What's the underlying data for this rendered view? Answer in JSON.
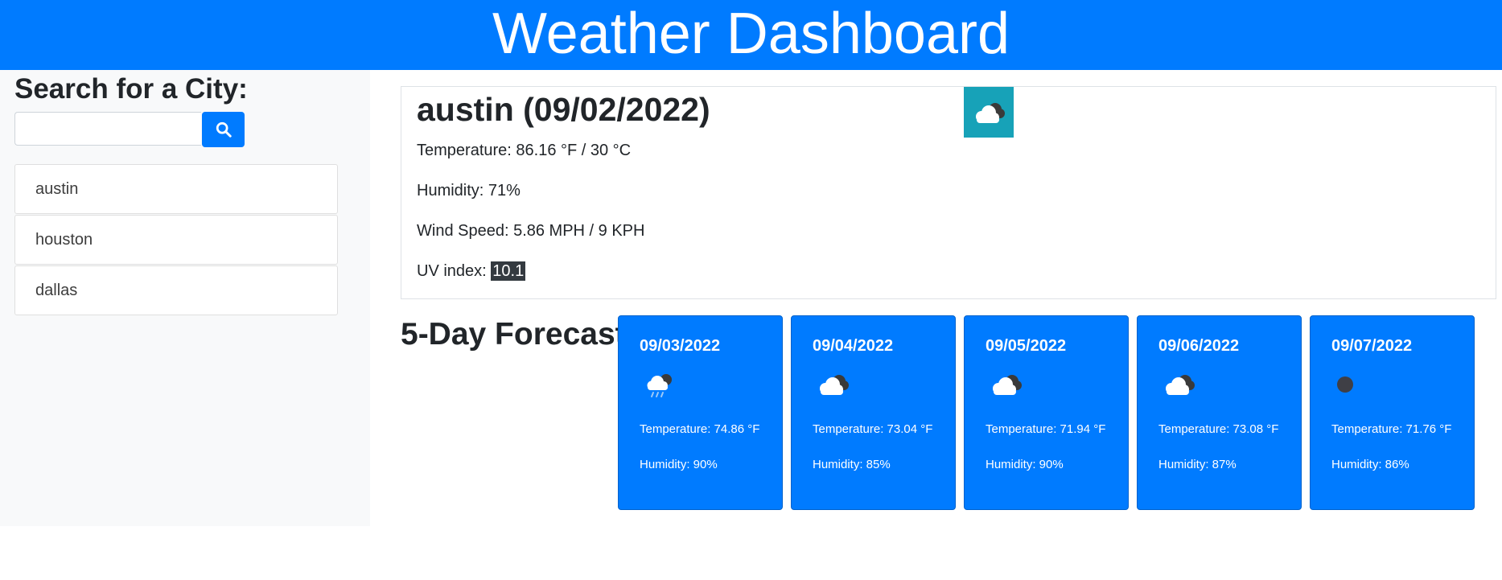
{
  "header": {
    "title": "Weather Dashboard"
  },
  "search": {
    "heading": "Search for a City:",
    "input_value": "",
    "placeholder": "",
    "button_icon": "search-icon"
  },
  "history": [
    {
      "label": "austin"
    },
    {
      "label": "houston"
    },
    {
      "label": "dallas"
    }
  ],
  "current": {
    "city_date": "austin (09/02/2022)",
    "icon": "cloudy-icon",
    "icon_bg": "#17a2b8",
    "temperature": "Temperature: 86.16 °F / 30 °C",
    "humidity": "Humidity: 71%",
    "wind": "Wind Speed: 5.86 MPH / 9 KPH",
    "uv_label": "UV index: ",
    "uv_value": "10.1"
  },
  "forecast": {
    "title": "5-Day Forecast",
    "cards": [
      {
        "date": "09/03/2022",
        "icon": "rain-cloud-icon",
        "temperature": "Temperature: 74.86 °F",
        "humidity": "Humidity: 90%"
      },
      {
        "date": "09/04/2022",
        "icon": "cloudy-icon",
        "temperature": "Temperature: 73.04 °F",
        "humidity": "Humidity: 85%"
      },
      {
        "date": "09/05/2022",
        "icon": "cloudy-icon",
        "temperature": "Temperature: 71.94 °F",
        "humidity": "Humidity: 90%"
      },
      {
        "date": "09/06/2022",
        "icon": "cloudy-icon",
        "temperature": "Temperature: 73.08 °F",
        "humidity": "Humidity: 87%"
      },
      {
        "date": "09/07/2022",
        "icon": "overcast-dot-icon",
        "temperature": "Temperature: 71.76 °F",
        "humidity": "Humidity: 86%"
      }
    ]
  },
  "colors": {
    "primary": "#007bff",
    "sidebar_bg": "#f8f9fa",
    "uv_badge": "#343a40"
  }
}
